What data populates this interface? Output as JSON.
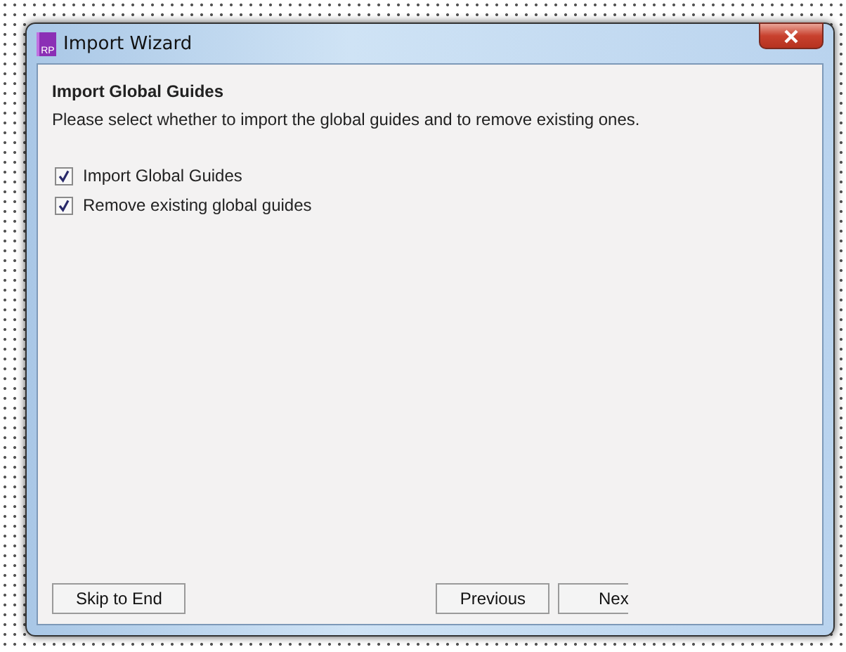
{
  "window": {
    "title": "Import Wizard",
    "app_icon": "RP"
  },
  "heading": "Import Global Guides",
  "description": "Please select whether to import the global guides and to remove existing ones.",
  "options": [
    {
      "label": "Import Global Guides",
      "checked": true
    },
    {
      "label": "Remove existing global guides",
      "checked": true
    }
  ],
  "buttons": [
    {
      "label": "Skip to End",
      "kind": "left"
    },
    {
      "label": "Previous",
      "kind": "right"
    },
    {
      "label": "Nex",
      "kind": "cut"
    }
  ]
}
